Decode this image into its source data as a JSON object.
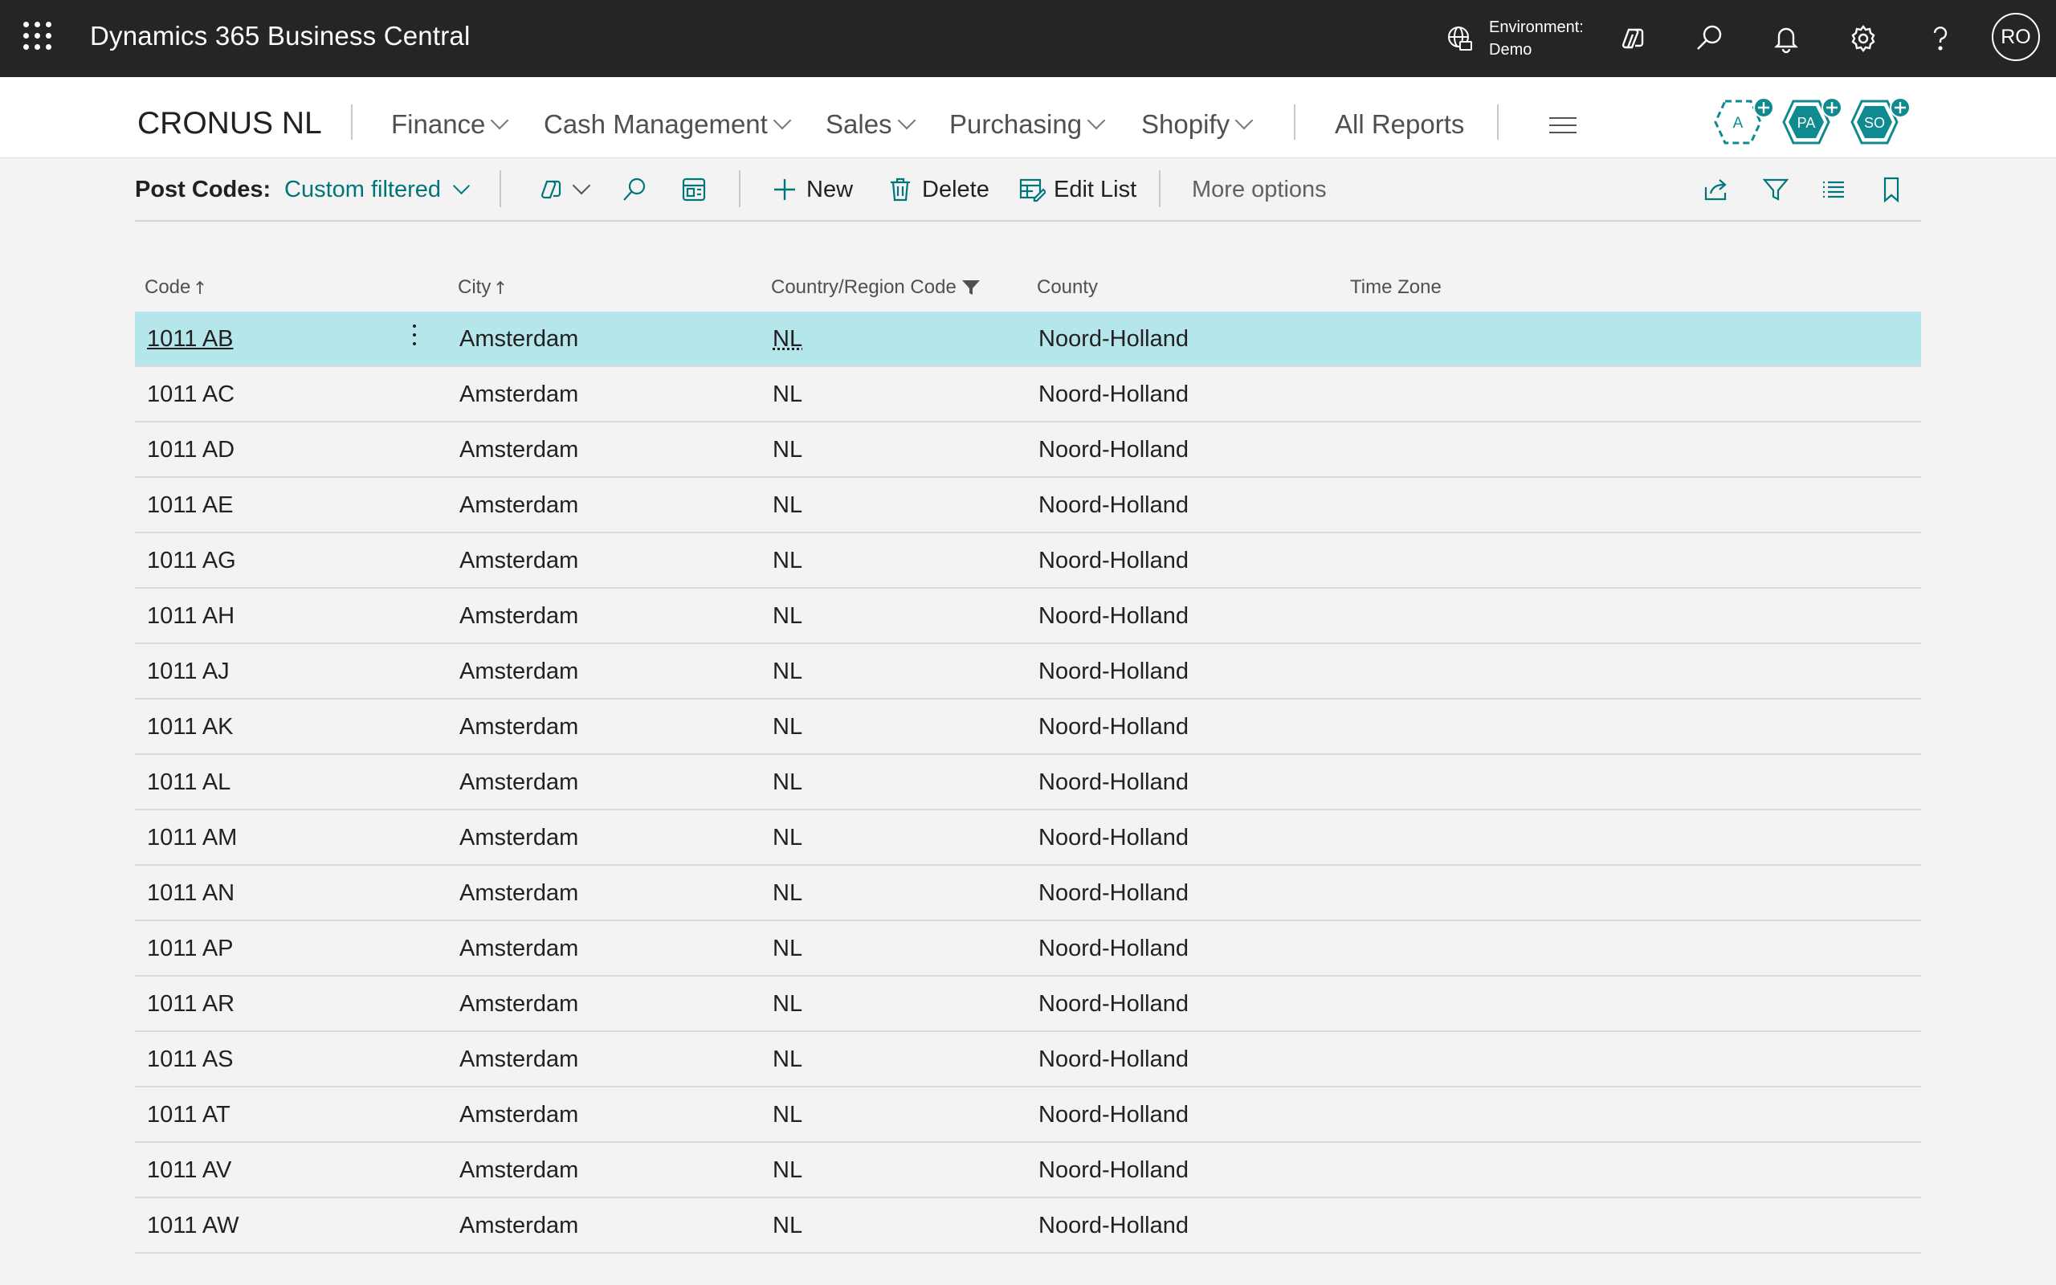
{
  "appbar": {
    "title": "Dynamics 365 Business Central",
    "env_label": "Environment:",
    "env_value": "Demo",
    "user_initials": "RO"
  },
  "nav": {
    "company": "CRONUS NL",
    "items": [
      {
        "label": "Finance"
      },
      {
        "label": "Cash Management"
      },
      {
        "label": "Sales"
      },
      {
        "label": "Purchasing"
      },
      {
        "label": "Shopify"
      }
    ],
    "all_reports": "All Reports",
    "agents": [
      "A",
      "PA",
      "SO"
    ]
  },
  "actions": {
    "page_caption": "Post Codes:",
    "filter_view": "Custom filtered",
    "new_label": "New",
    "delete_label": "Delete",
    "edit_list_label": "Edit List",
    "more_options_label": "More options"
  },
  "table": {
    "columns": {
      "code": "Code",
      "city": "City",
      "country": "Country/Region Code",
      "county": "County",
      "timezone": "Time Zone"
    },
    "rows": [
      {
        "code": "1011 AB",
        "city": "Amsterdam",
        "country": "NL",
        "county": "Noord-Holland",
        "timezone": ""
      },
      {
        "code": "1011 AC",
        "city": "Amsterdam",
        "country": "NL",
        "county": "Noord-Holland",
        "timezone": ""
      },
      {
        "code": "1011 AD",
        "city": "Amsterdam",
        "country": "NL",
        "county": "Noord-Holland",
        "timezone": ""
      },
      {
        "code": "1011 AE",
        "city": "Amsterdam",
        "country": "NL",
        "county": "Noord-Holland",
        "timezone": ""
      },
      {
        "code": "1011 AG",
        "city": "Amsterdam",
        "country": "NL",
        "county": "Noord-Holland",
        "timezone": ""
      },
      {
        "code": "1011 AH",
        "city": "Amsterdam",
        "country": "NL",
        "county": "Noord-Holland",
        "timezone": ""
      },
      {
        "code": "1011 AJ",
        "city": "Amsterdam",
        "country": "NL",
        "county": "Noord-Holland",
        "timezone": ""
      },
      {
        "code": "1011 AK",
        "city": "Amsterdam",
        "country": "NL",
        "county": "Noord-Holland",
        "timezone": ""
      },
      {
        "code": "1011 AL",
        "city": "Amsterdam",
        "country": "NL",
        "county": "Noord-Holland",
        "timezone": ""
      },
      {
        "code": "1011 AM",
        "city": "Amsterdam",
        "country": "NL",
        "county": "Noord-Holland",
        "timezone": ""
      },
      {
        "code": "1011 AN",
        "city": "Amsterdam",
        "country": "NL",
        "county": "Noord-Holland",
        "timezone": ""
      },
      {
        "code": "1011 AP",
        "city": "Amsterdam",
        "country": "NL",
        "county": "Noord-Holland",
        "timezone": ""
      },
      {
        "code": "1011 AR",
        "city": "Amsterdam",
        "country": "NL",
        "county": "Noord-Holland",
        "timezone": ""
      },
      {
        "code": "1011 AS",
        "city": "Amsterdam",
        "country": "NL",
        "county": "Noord-Holland",
        "timezone": ""
      },
      {
        "code": "1011 AT",
        "city": "Amsterdam",
        "country": "NL",
        "county": "Noord-Holland",
        "timezone": ""
      },
      {
        "code": "1011 AV",
        "city": "Amsterdam",
        "country": "NL",
        "county": "Noord-Holland",
        "timezone": ""
      },
      {
        "code": "1011 AW",
        "city": "Amsterdam",
        "country": "NL",
        "county": "Noord-Holland",
        "timezone": ""
      }
    ]
  },
  "colors": {
    "appbar_bg": "#252525",
    "accent": "#00757a",
    "selected_row": "#b5e6eb",
    "agent_teal": "#0f8a8f"
  },
  "icons": [
    "waffle-icon",
    "globe-icon",
    "copilot-icon",
    "search-icon",
    "bell-icon",
    "gear-icon",
    "help-icon",
    "hamburger-icon",
    "share-icon",
    "filter-icon",
    "list-icon",
    "bookmark-icon",
    "plus-icon",
    "trash-icon",
    "edit-list-icon",
    "open-in-excel-icon",
    "sort-asc-icon"
  ]
}
